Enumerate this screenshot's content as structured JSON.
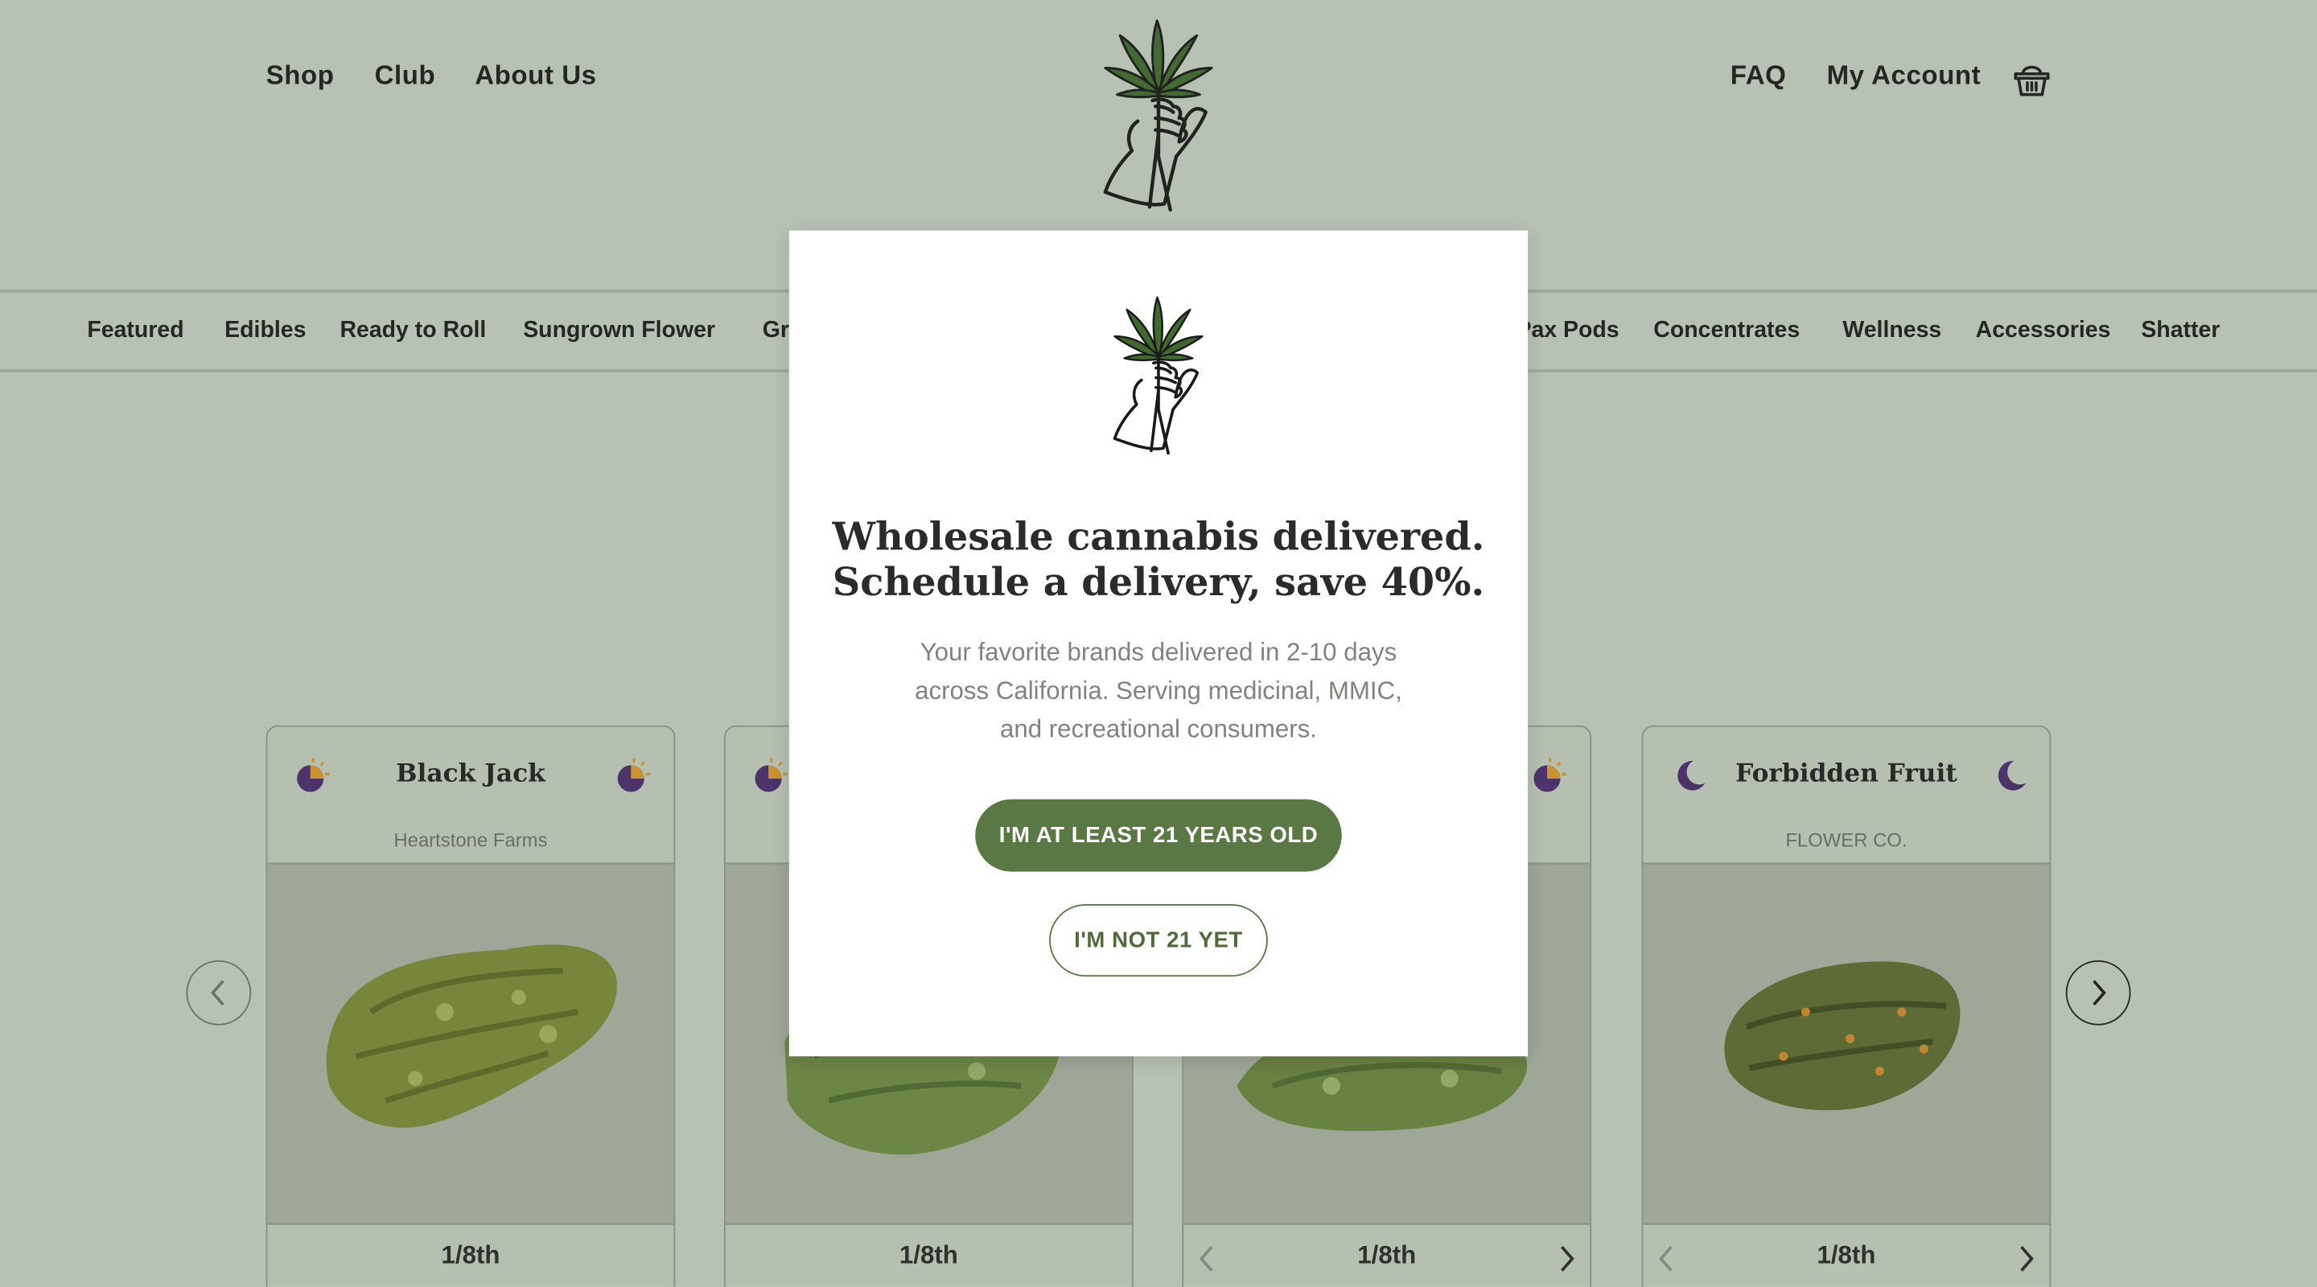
{
  "header": {
    "nav_left": [
      "Shop",
      "Club",
      "About Us"
    ],
    "nav_right": [
      "FAQ",
      "My Account"
    ],
    "cart_icon": "basket-icon",
    "logo_icon": "hand-holding-leaf-logo"
  },
  "categories": [
    "Featured",
    "Edibles",
    "Ready to Roll",
    "Sungrown Flower",
    "Gr",
    "Pax Pods",
    "Concentrates",
    "Wellness",
    "Accessories",
    "Shatter"
  ],
  "carousel": {
    "prev_icon": "chevron-left-icon",
    "next_icon": "chevron-right-icon",
    "cards": [
      {
        "name": "Black Jack",
        "brand": "Heartstone Farms",
        "size": "1/8th",
        "icon": "hybrid-sun-moon-icon"
      },
      {
        "name": "",
        "brand": "",
        "size": "1/8th",
        "icon": "hybrid-sun-moon-icon"
      },
      {
        "name": "",
        "brand": "",
        "size": "1/8th",
        "icon": "hybrid-sun-moon-icon"
      },
      {
        "name": "Forbidden Fruit",
        "brand": "FLOWER CO.",
        "size": "1/8th",
        "icon": "moon-icon"
      }
    ]
  },
  "modal": {
    "title_line1": "Wholesale cannabis delivered.",
    "title_line2": "Schedule a delivery, save 40%.",
    "subtitle_line1": "Your favorite brands delivered in 2-10 days",
    "subtitle_line2": "across California. Serving medicinal, MMIC,",
    "subtitle_line3": "and recreational consumers.",
    "confirm_label": "I'M AT LEAST 21 YEARS OLD",
    "deny_label": "I'M NOT 21 YET"
  },
  "colors": {
    "brand_green": "#5a7843",
    "leaf_green": "#3f6a2e",
    "indica_purple": "#4a2d6e",
    "sativa_orange": "#d99a2b"
  }
}
